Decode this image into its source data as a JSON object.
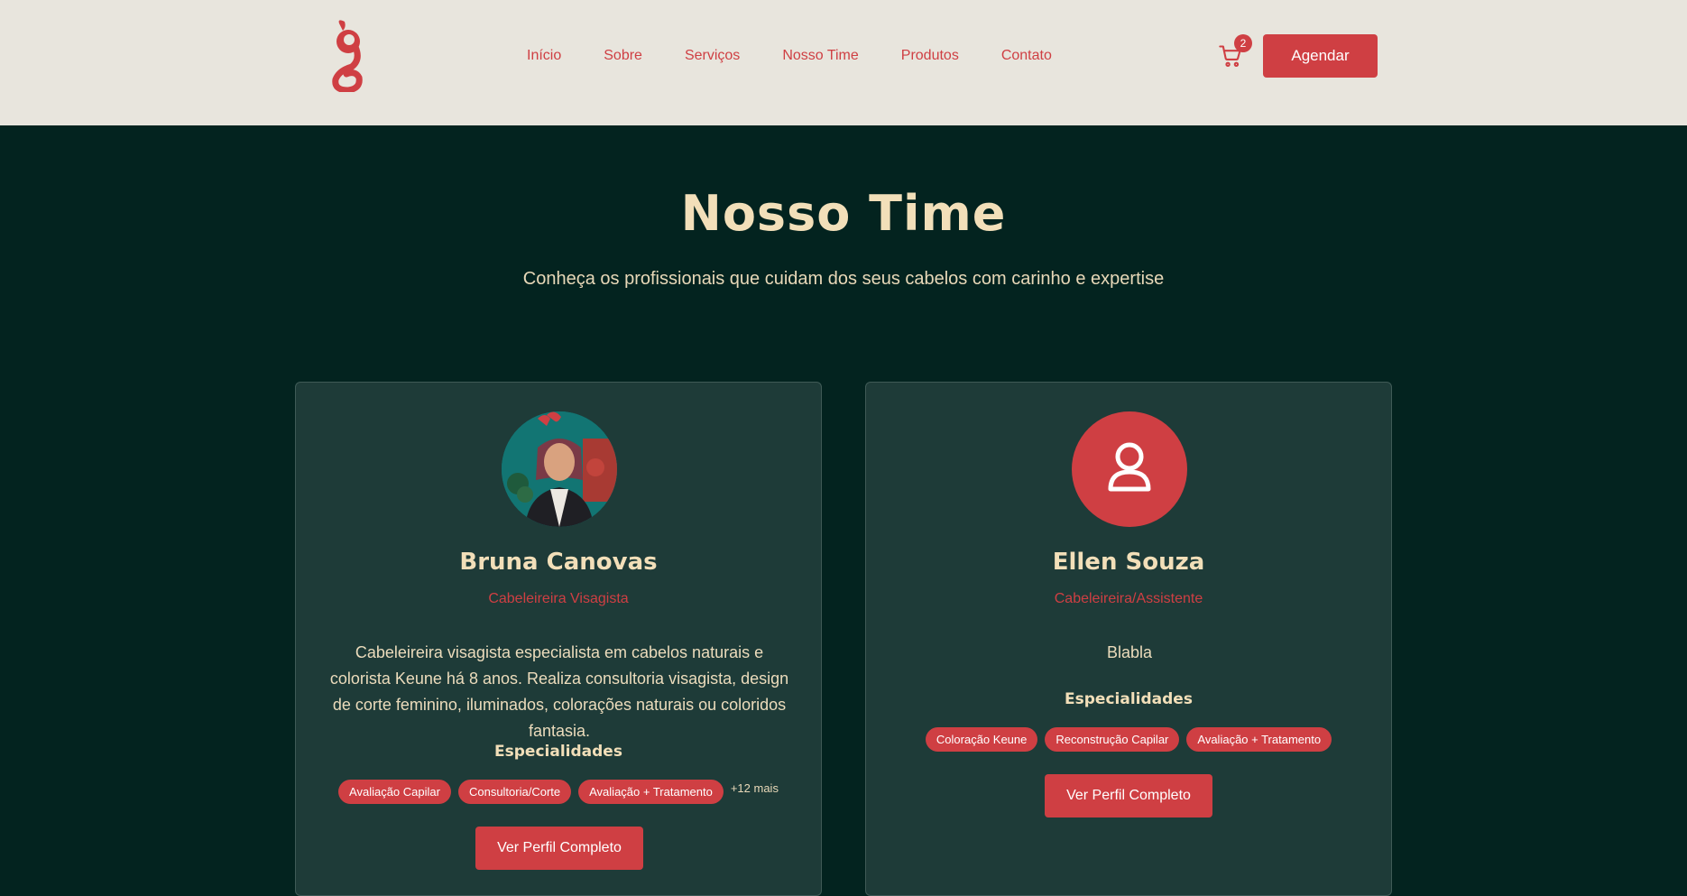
{
  "header": {
    "nav": [
      "Início",
      "Sobre",
      "Serviços",
      "Nosso Time",
      "Produtos",
      "Contato"
    ],
    "cart_count": "2",
    "cta_label": "Agendar"
  },
  "hero": {
    "title": "Nosso Time",
    "subtitle": "Conheça os profissionais que cuidam dos seus cabelos com carinho e expertise"
  },
  "team": [
    {
      "name": "Bruna Canovas",
      "role": "Cabeleireira Visagista",
      "bio": "Cabeleireira visagista especialista em cabelos naturais e colorista Keune há 8 anos. Realiza consultoria visagista, design de corte feminino, iluminados, colorações naturais ou coloridos fantasia.",
      "specialties_title": "Especialidades",
      "specialties": [
        "Avaliação Capilar",
        "Consultoria/Corte",
        "Avaliação + Tratamento"
      ],
      "more": "+12 mais",
      "button": "Ver Perfil Completo",
      "avatar": "photo"
    },
    {
      "name": "Ellen Souza",
      "role": "Cabeleireira/Assistente",
      "bio": "Blabla",
      "specialties_title": "Especialidades",
      "specialties": [
        "Coloração Keune",
        "Reconstrução Capilar",
        "Avaliação + Tratamento"
      ],
      "button": "Ver Perfil Completo",
      "avatar": "user-icon"
    }
  ],
  "colors": {
    "accent": "#cf3f43",
    "header_bg": "#e8e5dd",
    "page_bg": "#03231f",
    "card_bg": "#1e3b38",
    "title": "#f2dfb9"
  }
}
